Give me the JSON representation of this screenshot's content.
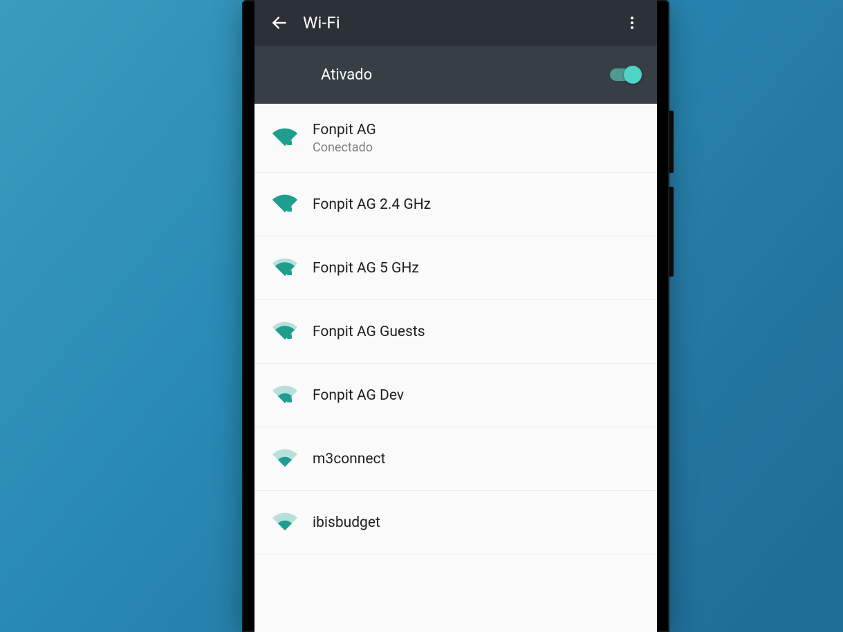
{
  "appbar": {
    "title": "Wi-Fi"
  },
  "toggle": {
    "label": "Ativado",
    "on": true
  },
  "networks": [
    {
      "ssid": "Fonpit AG",
      "status": "Conectado",
      "signal": 4,
      "locked": true
    },
    {
      "ssid": "Fonpit AG 2.4 GHz",
      "status": "",
      "signal": 4,
      "locked": true
    },
    {
      "ssid": "Fonpit AG 5 GHz",
      "status": "",
      "signal": 3,
      "locked": true
    },
    {
      "ssid": "Fonpit AG Guests",
      "status": "",
      "signal": 3,
      "locked": true
    },
    {
      "ssid": "Fonpit AG Dev",
      "status": "",
      "signal": 2,
      "locked": true
    },
    {
      "ssid": "m3connect",
      "status": "",
      "signal": 2,
      "locked": false
    },
    {
      "ssid": "ibisbudget",
      "status": "",
      "signal": 2,
      "locked": false
    }
  ],
  "colors": {
    "accent": "#1f9e8f",
    "accentLight": "#b7e0db",
    "thumb": "#4fd3c4"
  }
}
